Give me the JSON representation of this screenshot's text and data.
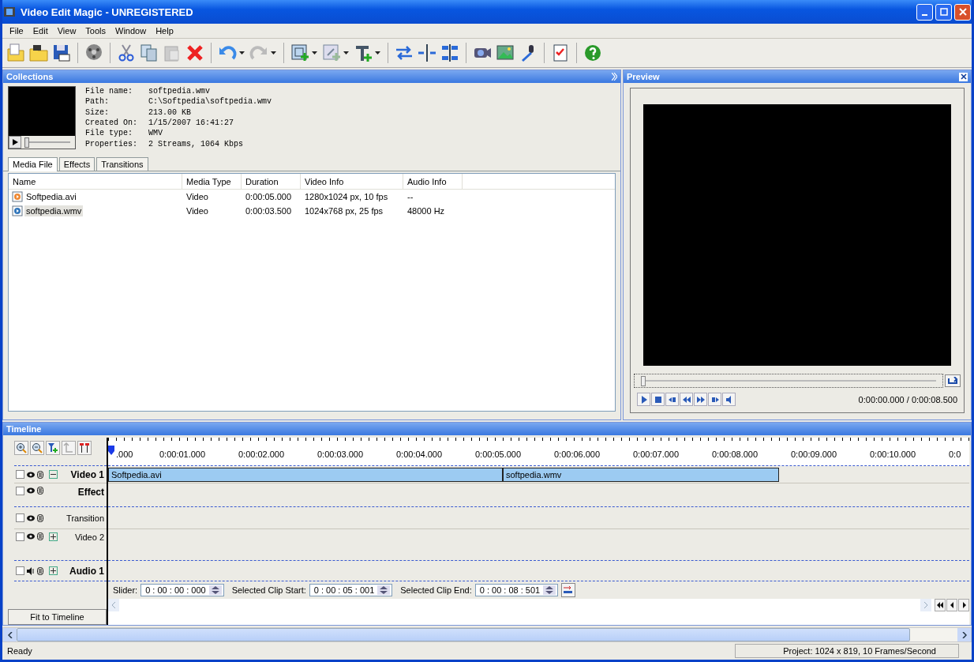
{
  "window": {
    "title": "Video Edit Magic - UNREGISTERED"
  },
  "menu": [
    "File",
    "Edit",
    "View",
    "Tools",
    "Window",
    "Help"
  ],
  "collections": {
    "title": "Collections",
    "player": {
      "level": 0
    },
    "info": [
      {
        "label": "File name:",
        "value": "softpedia.wmv"
      },
      {
        "label": "Path:",
        "value": "C:\\Softpedia\\softpedia.wmv"
      },
      {
        "label": "Size:",
        "value": "213.00 KB"
      },
      {
        "label": "Created On:",
        "value": "1/15/2007 16:41:27"
      },
      {
        "label": "File type:",
        "value": "WMV"
      },
      {
        "label": "Properties:",
        "value": "2 Streams, 1064 Kbps"
      }
    ],
    "tabs": [
      {
        "label": "Media File",
        "selected": true
      },
      {
        "label": "Effects",
        "selected": false
      },
      {
        "label": "Transitions",
        "selected": false
      }
    ],
    "columns": [
      "Name",
      "Media Type",
      "Duration",
      "Video Info",
      "Audio Info"
    ],
    "rows": [
      {
        "cells": [
          "Softpedia.avi",
          "Video",
          "0:00:05.000",
          "1280x1024 px, 10 fps",
          "--"
        ],
        "selected": false
      },
      {
        "cells": [
          "softpedia.wmv",
          "Video",
          "0:00:03.500",
          "1024x768 px, 25 fps",
          "48000 Hz"
        ],
        "selected": true
      }
    ]
  },
  "preview": {
    "title": "Preview",
    "slider": {
      "level": 0
    },
    "time": "0:00:00.000 / 0:00:08.500"
  },
  "timeline": {
    "title": "Timeline",
    "ruler": [
      ".000",
      "0:00:01.000",
      "0:00:02.000",
      "0:00:03.000",
      "0:00:04.000",
      "0:00:05.000",
      "0:00:06.000",
      "0:00:07.000",
      "0:00:08.000",
      "0:00:09.000",
      "0:00:10.000",
      "0:0"
    ],
    "tracks": [
      {
        "kind": "video",
        "label": "Video 1",
        "emphasized": true,
        "checked": false,
        "expanded": true,
        "clips": [
          {
            "label": "Softpedia.avi"
          },
          {
            "label": "softpedia.wmv"
          }
        ]
      },
      {
        "kind": "effect",
        "label": "Effect",
        "emphasized": true,
        "checked": false
      },
      {
        "kind": "transition",
        "label": "Transition",
        "emphasized": false,
        "checked": false
      },
      {
        "kind": "video",
        "label": "Video 2",
        "emphasized": false,
        "checked": false,
        "expanded": false
      },
      {
        "kind": "audio",
        "label": "Audio 1",
        "emphasized": true,
        "checked": false,
        "expanded": false
      }
    ],
    "fields": [
      {
        "label": "Slider:",
        "value": "0 : 00 : 00 : 000"
      },
      {
        "label": "Selected Clip Start:",
        "value": "0 : 00 : 05 : 001"
      },
      {
        "label": "Selected Clip End:",
        "value": "0 : 00 : 08 : 501"
      }
    ],
    "fit_button": "Fit to Timeline"
  },
  "status_bar": {
    "left": "Ready",
    "right": "Project: 1024 x 819, 10 Frames/Second"
  }
}
